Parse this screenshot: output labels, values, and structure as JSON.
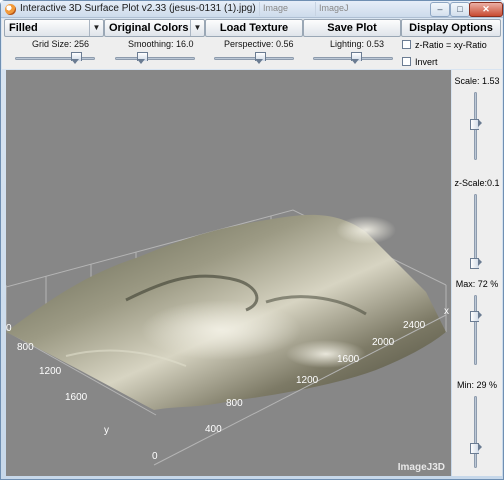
{
  "window": {
    "title": "Interactive 3D Surface Plot v2.33  (jesus-0131 (1).jpg)",
    "bg_tabs": [
      "Image",
      "ImageJ"
    ],
    "minimize_icon": "minimize-icon",
    "maximize_icon": "maximize-icon",
    "close_icon": "close-icon"
  },
  "toolbar": {
    "mode_select": "Filled",
    "color_select": "Original Colors",
    "load_texture": "Load Texture",
    "save_plot": "Save Plot",
    "display_options": "Display Options",
    "dropdown_icon": "chevron-down-icon"
  },
  "sliders": {
    "grid_size": {
      "label": "Grid Size: 256",
      "value": 0.75
    },
    "smoothing": {
      "label": "Smoothing: 16.0",
      "value": 0.32
    },
    "perspective": {
      "label": "Perspective: 0.56",
      "value": 0.56
    },
    "lighting": {
      "label": "Lighting: 0.53",
      "value": 0.53
    }
  },
  "checkboxes": {
    "z_ratio": {
      "label": "z-Ratio = xy-Ratio",
      "checked": false
    },
    "invert": {
      "label": "Invert",
      "checked": false
    }
  },
  "right_panel": {
    "scale": {
      "label": "Scale: 1.53",
      "value": 0.55
    },
    "z_scale": {
      "label": "z-Scale:0.1",
      "value": 0.05
    },
    "max": {
      "label": "Max: 72 %",
      "value": 0.72
    },
    "min": {
      "label": "Min: 29 %",
      "value": 0.29
    }
  },
  "plot": {
    "x_axis_name": "x",
    "y_axis_name": "y",
    "x_ticks": [
      "0",
      "400",
      "800",
      "1200",
      "1600",
      "2000",
      "2400"
    ],
    "y_ticks": [
      "0",
      "800",
      "1200",
      "1600"
    ],
    "watermark": "ImageJ3D",
    "background": "#878787"
  }
}
